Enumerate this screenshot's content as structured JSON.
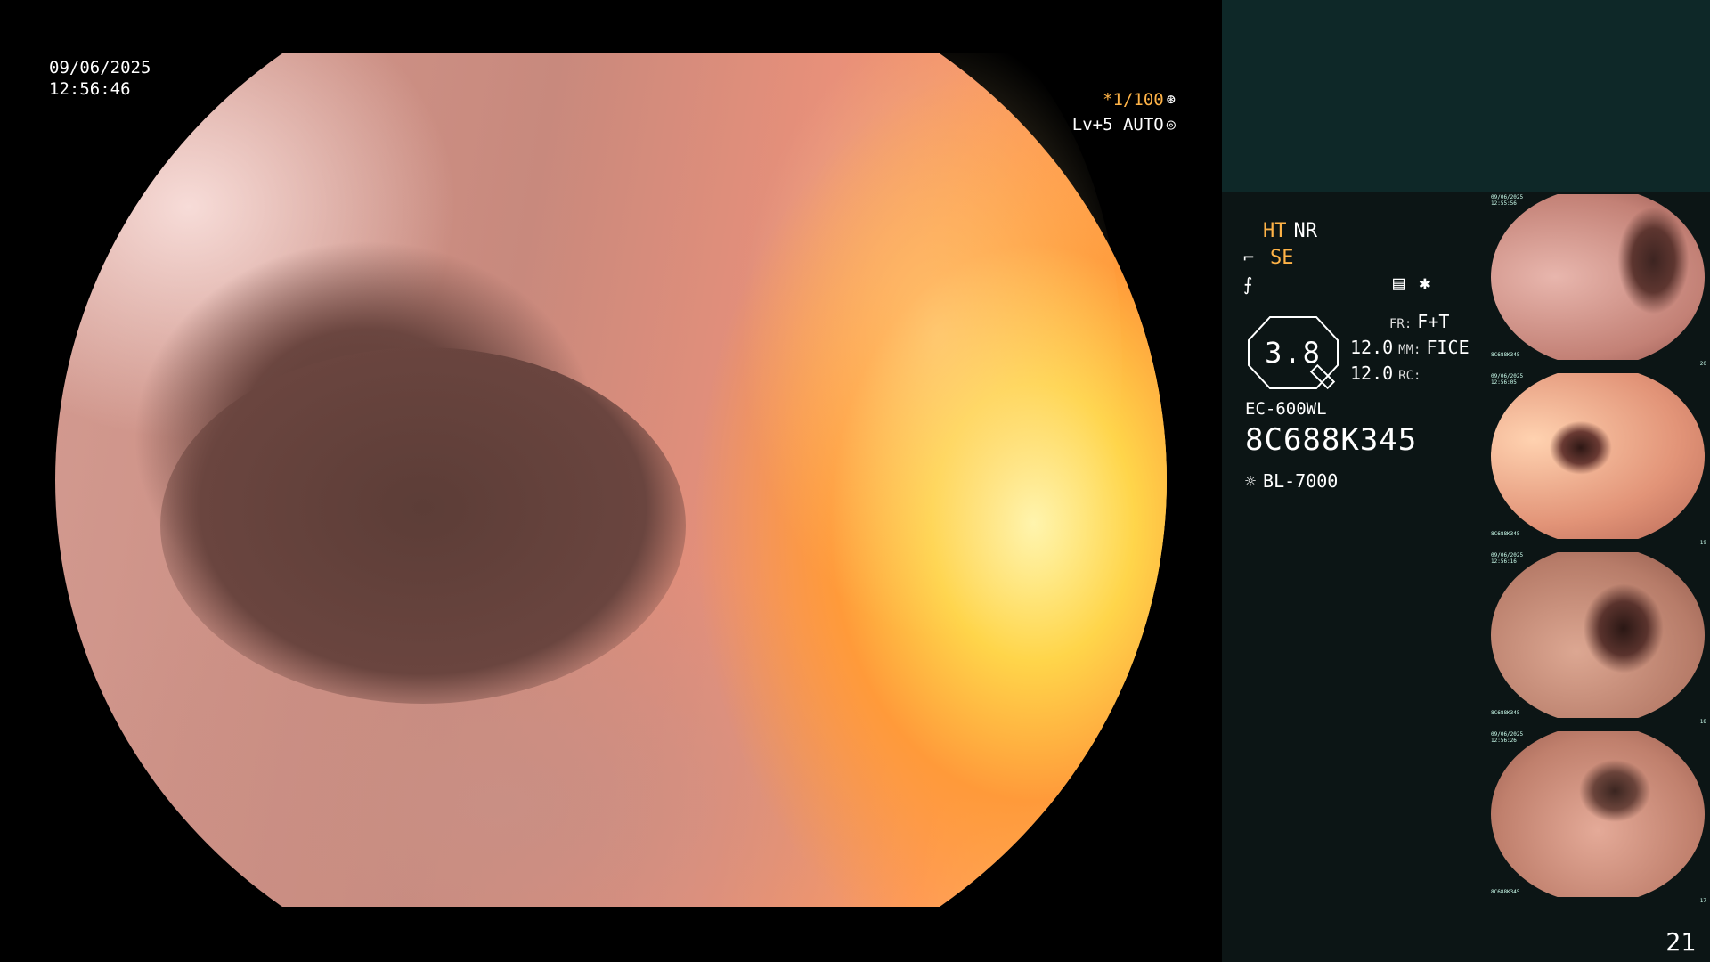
{
  "main": {
    "date": "09/06/2025",
    "time": "12:56:46",
    "shutter": "*1/100",
    "level": "Lv+5 AUTO"
  },
  "panel": {
    "ht": "HT",
    "nr": "NR",
    "se": "SE",
    "gauge_value": "3.8",
    "value_1": "12.0",
    "value_2": "12.0",
    "fr_tag": "FR:",
    "fr_value": "F+T",
    "mm_tag": "MM:",
    "mm_value": "FICE",
    "rc_tag": "RC:",
    "scope_model": "EC-600WL",
    "serial": "8C688K345",
    "light_source": "BL-7000",
    "page_number": "21"
  },
  "thumbnails": [
    {
      "date": "09/06/2025",
      "time": "12:55:56",
      "serial": "8C688K345",
      "num": "20"
    },
    {
      "date": "09/06/2025",
      "time": "12:56:05",
      "serial": "8C688K345",
      "num": "19"
    },
    {
      "date": "09/06/2025",
      "time": "12:56:16",
      "serial": "8C688K345",
      "num": "18"
    },
    {
      "date": "09/06/2025",
      "time": "12:56:26",
      "serial": "8C688K345",
      "num": "17"
    }
  ],
  "icons": {
    "shutter": "aperture-icon",
    "auto": "iris-icon",
    "se": "scope-tip-icon",
    "slash": "zoom-icon",
    "settings": "settings-panel-icon",
    "star": "asterisk-icon",
    "light": "light-source-icon"
  }
}
